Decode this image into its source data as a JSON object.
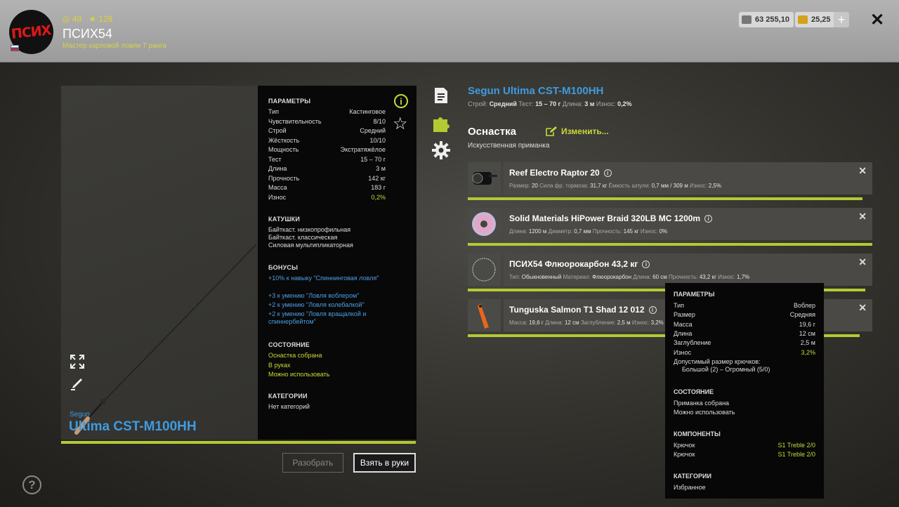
{
  "header": {
    "avatar_text": "ПСИХ",
    "level": "49",
    "stars": "128",
    "username": "ПСИХ54",
    "rank": "Мастер карповой ловли 7 ранга",
    "silver": "63 255,10",
    "gold": "25,25",
    "plus": "+",
    "close": "✕"
  },
  "rod": {
    "brand": "Segun",
    "model": "Ultima CST-M100HH",
    "full_name": "Segun Ultima CST-M100HH",
    "wear_fraction": 0.998
  },
  "params": {
    "title": "ПАРАМЕТРЫ",
    "rows": [
      {
        "label": "Тип",
        "value": "Кастинговое"
      },
      {
        "label": "Чувствительность",
        "value": "8/10"
      },
      {
        "label": "Строй",
        "value": "Средний"
      },
      {
        "label": "Жёсткость",
        "value": "10/10"
      },
      {
        "label": "Мощность",
        "value": "Экстратяжёлое"
      },
      {
        "label": "Тест",
        "value": "15 – 70 г"
      },
      {
        "label": "Длина",
        "value": "3 м"
      },
      {
        "label": "Прочность",
        "value": "142 кг"
      },
      {
        "label": "Масса",
        "value": "183 г"
      },
      {
        "label": "Износ",
        "value": "0,2%"
      }
    ],
    "reels_title": "КАТУШКИ",
    "reels": [
      "Байткаст. низкопрофильная",
      "Байткаст. классическая",
      "Силовая мультипликаторная"
    ],
    "bonus_title": "БОНУСЫ",
    "bonuses": [
      "+10% к навыку \"Спиннинговая ловля\"",
      "+3 к умению \"Ловля воблером\"",
      "+2 к умению \"Ловля колебалкой\"",
      "+2 к умению \"Ловля вращалкой и спиннербейтом\""
    ],
    "state_title": "СОСТОЯНИЕ",
    "states": [
      "Оснастка собрана",
      "В руках",
      "Можно использовать"
    ],
    "cat_title": "КАТЕГОРИИ",
    "cat_value": "Нет категорий"
  },
  "buttons": {
    "disassemble": "Разобрать",
    "take": "Взять в руки"
  },
  "right": {
    "specs": {
      "build_label": "Строй:",
      "build": "Средний",
      "test_label": "Тест:",
      "test": "15 – 70 г",
      "length_label": "Длина:",
      "length": "3 м",
      "wear_label": "Износ:",
      "wear": "0,2%"
    },
    "tackle_title": "Оснастка",
    "edit_label": "Изменить...",
    "tackle_sub": "Искусственная приманка"
  },
  "items": [
    {
      "name": "Reef Electro Raptor 20",
      "stats": [
        {
          "label": "Размер:",
          "value": "20"
        },
        {
          "label": "Сила фр. тормоза:",
          "value": "31,7 кг"
        },
        {
          "label": "Ёмкость шпули:",
          "value": "0,7 мм / 309 м"
        },
        {
          "label": "Износ:",
          "value": "2,5%",
          "accent": true
        }
      ],
      "bar": 0.975
    },
    {
      "name": "Solid Materials HiPower Braid 320LB MC 1200m",
      "stats": [
        {
          "label": "Длина:",
          "value": "1200 м"
        },
        {
          "label": "Диаметр:",
          "value": "0,7 мм"
        },
        {
          "label": "Прочность:",
          "value": "145 кг"
        },
        {
          "label": "Износ:",
          "value": "0%",
          "accent": true
        }
      ],
      "bar": 1.0
    },
    {
      "name": "ПСИХ54 Флюорокарбон 43,2 кг",
      "stats": [
        {
          "label": "Тип:",
          "value": "Обыкновенный"
        },
        {
          "label": "Материал:",
          "value": "Флюорокарбон"
        },
        {
          "label": "Длина:",
          "value": "60 см"
        },
        {
          "label": "Прочность:",
          "value": "43,2 кг"
        },
        {
          "label": "Износ:",
          "value": "1,7%",
          "accent": true
        }
      ],
      "bar": 0.983
    },
    {
      "name": "Tunguska Salmon T1 Shad 12 012",
      "stats": [
        {
          "label": "Масса:",
          "value": "19,6 г"
        },
        {
          "label": "Длина:",
          "value": "12 см"
        },
        {
          "label": "Заглубление:",
          "value": "2,5 м"
        },
        {
          "label": "Износ:",
          "value": "3,2%",
          "accent": true
        }
      ],
      "bar": 0.968
    }
  ],
  "tooltip": {
    "title": "ПАРАМЕТРЫ",
    "rows": [
      {
        "label": "Тип",
        "value": "Воблер"
      },
      {
        "label": "Размер",
        "value": "Средняя"
      },
      {
        "label": "Масса",
        "value": "19,6 г"
      },
      {
        "label": "Длина",
        "value": "12 см"
      },
      {
        "label": "Заглубление",
        "value": "2,5 м"
      },
      {
        "label": "Износ",
        "value": "3,2%"
      }
    ],
    "hook_size_label": "Допустимый размер крючков:",
    "hook_size_value": "Большой (2) – Огромный (5/0)",
    "state_title": "СОСТОЯНИЕ",
    "states": [
      "Приманка собрана",
      "Можно использовать"
    ],
    "comp_title": "КОМПОНЕНТЫ",
    "components": [
      {
        "label": "Крючок",
        "value": "S1 Treble 2/0"
      },
      {
        "label": "Крючок",
        "value": "S1 Treble 2/0"
      }
    ],
    "cat_title": "КАТЕГОРИИ",
    "cat_value": "Избранное"
  },
  "colors": {
    "accent": "#b5c934",
    "blue": "#3f9be0"
  }
}
